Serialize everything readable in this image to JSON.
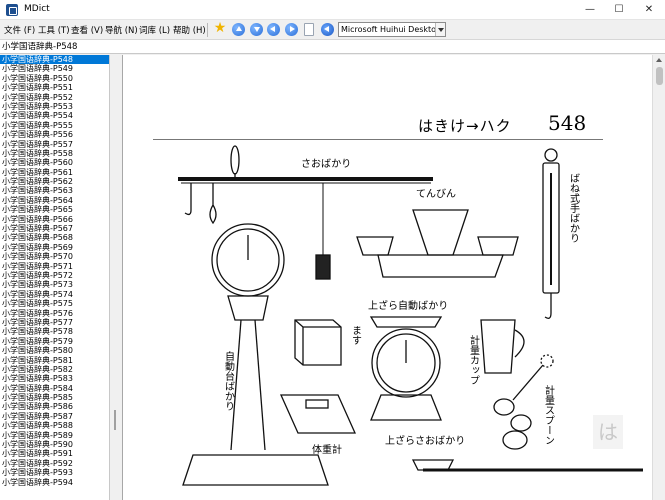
{
  "window": {
    "title": "MDict",
    "controls": {
      "minimize": "—",
      "maximize": "☐",
      "close": "✕"
    }
  },
  "menu": [
    {
      "label": "文件 (F)"
    },
    {
      "label": "工具 (T)"
    },
    {
      "label": "查看 (V)"
    },
    {
      "label": "导航 (N)"
    },
    {
      "label": "词库 (L)"
    },
    {
      "label": "帮助 (H)"
    }
  ],
  "toolbar": {
    "icons": [
      "favorite-star-icon",
      "back-up-icon",
      "forward-down-icon",
      "previous-icon",
      "next-icon",
      "copy-doc-icon",
      "speaker-icon"
    ],
    "font_select": "Microsoft Huihui Desktop - C"
  },
  "search": {
    "value": "小学国语辞典-P548"
  },
  "sidebar": {
    "selected_index": 0,
    "items": [
      "小学国语辞典-P548",
      "小学国语辞典-P549",
      "小学国语辞典-P550",
      "小学国语辞典-P551",
      "小学国语辞典-P552",
      "小学国语辞典-P553",
      "小学国语辞典-P554",
      "小学国语辞典-P555",
      "小学国语辞典-P556",
      "小学国语辞典-P557",
      "小学国语辞典-P558",
      "小学国语辞典-P560",
      "小学国语辞典-P561",
      "小学国语辞典-P562",
      "小学国语辞典-P563",
      "小学国语辞典-P564",
      "小学国语辞典-P565",
      "小学国语辞典-P566",
      "小学国语辞典-P567",
      "小学国语辞典-P568",
      "小学国语辞典-P569",
      "小学国语辞典-P570",
      "小学国语辞典-P571",
      "小学国语辞典-P572",
      "小学国语辞典-P573",
      "小学国语辞典-P574",
      "小学国语辞典-P575",
      "小学国语辞典-P576",
      "小学国语辞典-P577",
      "小学国语辞典-P578",
      "小学国语辞典-P579",
      "小学国语辞典-P580",
      "小学国语辞典-P581",
      "小学国语辞典-P582",
      "小学国语辞典-P583",
      "小学国语辞典-P584",
      "小学国语辞典-P585",
      "小学国语辞典-P586",
      "小学国语辞典-P587",
      "小学国语辞典-P588",
      "小学国语辞典-P589",
      "小学国语辞典-P590",
      "小学国语辞典-P591",
      "小学国语辞典-P592",
      "小学国语辞典-P593",
      "小学国语辞典-P594"
    ]
  },
  "page": {
    "header": "はきけ→ハク",
    "number": "548",
    "labels": {
      "saobakari": "さおばかり",
      "tenbin": "てんびん",
      "banesiki": "ばね式手ばかり",
      "uezara": "上ざら自動ばかり",
      "masu": "ます",
      "jidoudai": "自動台ばかり",
      "keiryoucup": "計量カップ",
      "keiryouspoon": "計量スプーン",
      "taijuukei": "体重計",
      "uezarasao": "上ざらさおばかり"
    },
    "watermark": "は"
  },
  "colors": {
    "selection": "#0078d7",
    "accent_star": "#f0b400",
    "toolbar_blue": "#2b6fd8"
  }
}
